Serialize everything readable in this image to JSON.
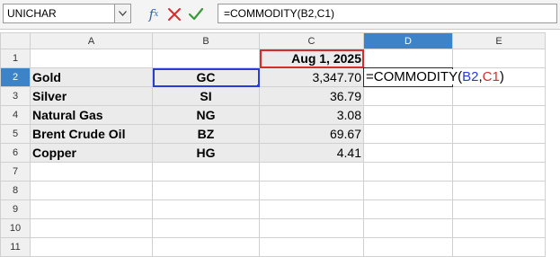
{
  "formula_bar": {
    "name_box": "UNICHAR",
    "fx_icon": "function-wizard-icon",
    "cancel_icon": "cancel-x-icon",
    "accept_icon": "accept-check-icon",
    "formula": "=COMMODITY(B2,C1)"
  },
  "columns": [
    "A",
    "B",
    "C",
    "D",
    "E"
  ],
  "rows": [
    "1",
    "2",
    "3",
    "4",
    "5",
    "6",
    "7",
    "8",
    "9",
    "10",
    "11"
  ],
  "active_column": "D",
  "active_row": "2",
  "header_date": "Aug 1, 2025",
  "data_rows": [
    {
      "name": "Gold",
      "code": "GC",
      "price": "3,347.70"
    },
    {
      "name": "Silver",
      "code": "SI",
      "price": "36.79"
    },
    {
      "name": "Natural Gas",
      "code": "NG",
      "price": "3.08"
    },
    {
      "name": "Brent Crude Oil",
      "code": "BZ",
      "price": "69.67"
    },
    {
      "name": "Copper",
      "code": "HG",
      "price": "4.41"
    }
  ],
  "editing_cell": {
    "prefix": "=COMMODITY(",
    "ref1": "B2",
    "sep": ",",
    "ref2": "C1",
    "suffix": ")"
  },
  "colors": {
    "ref1": "#2a3cd6",
    "ref2": "#d62c2c",
    "active_header": "#3c83c7"
  }
}
